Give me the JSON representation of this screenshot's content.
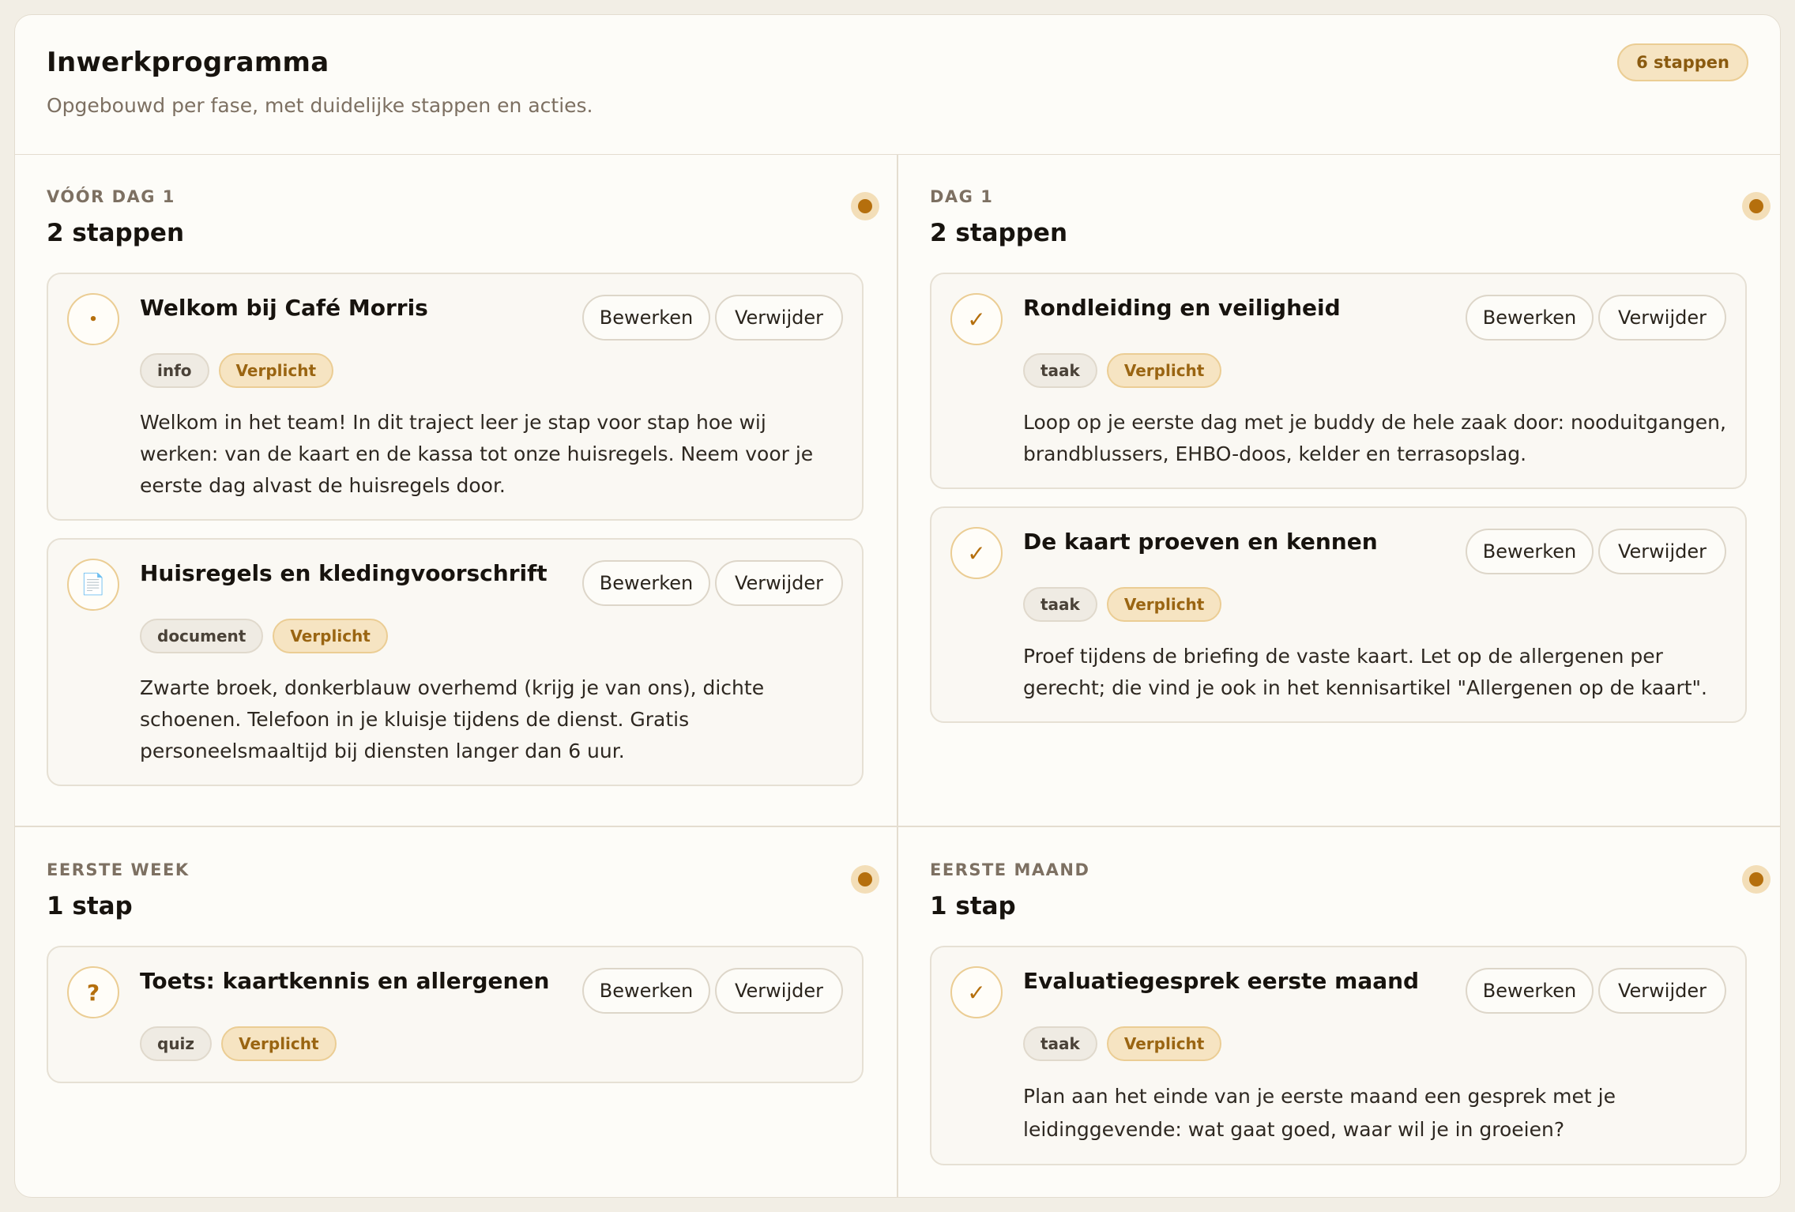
{
  "header": {
    "title": "Inwerkprogramma",
    "subtitle": "Opgebouwd per fase, met duidelijke stappen en acties.",
    "total_badge": "6 stappen"
  },
  "labels": {
    "edit": "Bewerken",
    "delete": "Verwijder"
  },
  "colors": {
    "accent": "#b56f0d",
    "required_bg": "#f6e4c2",
    "card_bg": "#fdfcf8"
  },
  "phases": [
    {
      "label": "VÓÓR DAG 1",
      "count": "2 stappen",
      "steps": [
        {
          "icon": "dot-icon",
          "icon_glyph": "•",
          "title": "Welkom bij Café Morris",
          "type": "info",
          "required": "Verplicht",
          "description": "Welkom in het team! In dit traject leer je stap voor stap hoe wij werken: van de kaart en de kassa tot onze huisregels. Neem voor je eerste dag alvast de huisregels door."
        },
        {
          "icon": "document-icon",
          "icon_glyph": "📄",
          "title": "Huisregels en kledingvoorschrift",
          "type": "document",
          "required": "Verplicht",
          "description": "Zwarte broek, donkerblauw overhemd (krijg je van ons), dichte schoenen. Telefoon in je kluisje tijdens de dienst. Gratis personeelsmaaltijd bij diensten langer dan 6 uur."
        }
      ]
    },
    {
      "label": "DAG 1",
      "count": "2 stappen",
      "steps": [
        {
          "icon": "check-icon",
          "icon_glyph": "✓",
          "title": "Rondleiding en veiligheid",
          "type": "taak",
          "required": "Verplicht",
          "description": "Loop op je eerste dag met je buddy de hele zaak door: nooduitgangen, brandblussers, EHBO-doos, kelder en terrasopslag."
        },
        {
          "icon": "check-icon",
          "icon_glyph": "✓",
          "title": "De kaart proeven en kennen",
          "type": "taak",
          "required": "Verplicht",
          "description": "Proef tijdens de briefing de vaste kaart. Let op de allergenen per gerecht; die vind je ook in het kennisartikel \"Allergenen op de kaart\"."
        }
      ]
    },
    {
      "label": "EERSTE WEEK",
      "count": "1 stap",
      "steps": [
        {
          "icon": "question-icon",
          "icon_glyph": "?",
          "title": "Toets: kaartkennis en allergenen",
          "type": "quiz",
          "required": "Verplicht",
          "description": ""
        }
      ]
    },
    {
      "label": "EERSTE MAAND",
      "count": "1 stap",
      "steps": [
        {
          "icon": "check-icon",
          "icon_glyph": "✓",
          "title": "Evaluatiegesprek eerste maand",
          "type": "taak",
          "required": "Verplicht",
          "description": "Plan aan het einde van je eerste maand een gesprek met je leidinggevende: wat gaat goed, waar wil je in groeien?"
        }
      ]
    }
  ]
}
